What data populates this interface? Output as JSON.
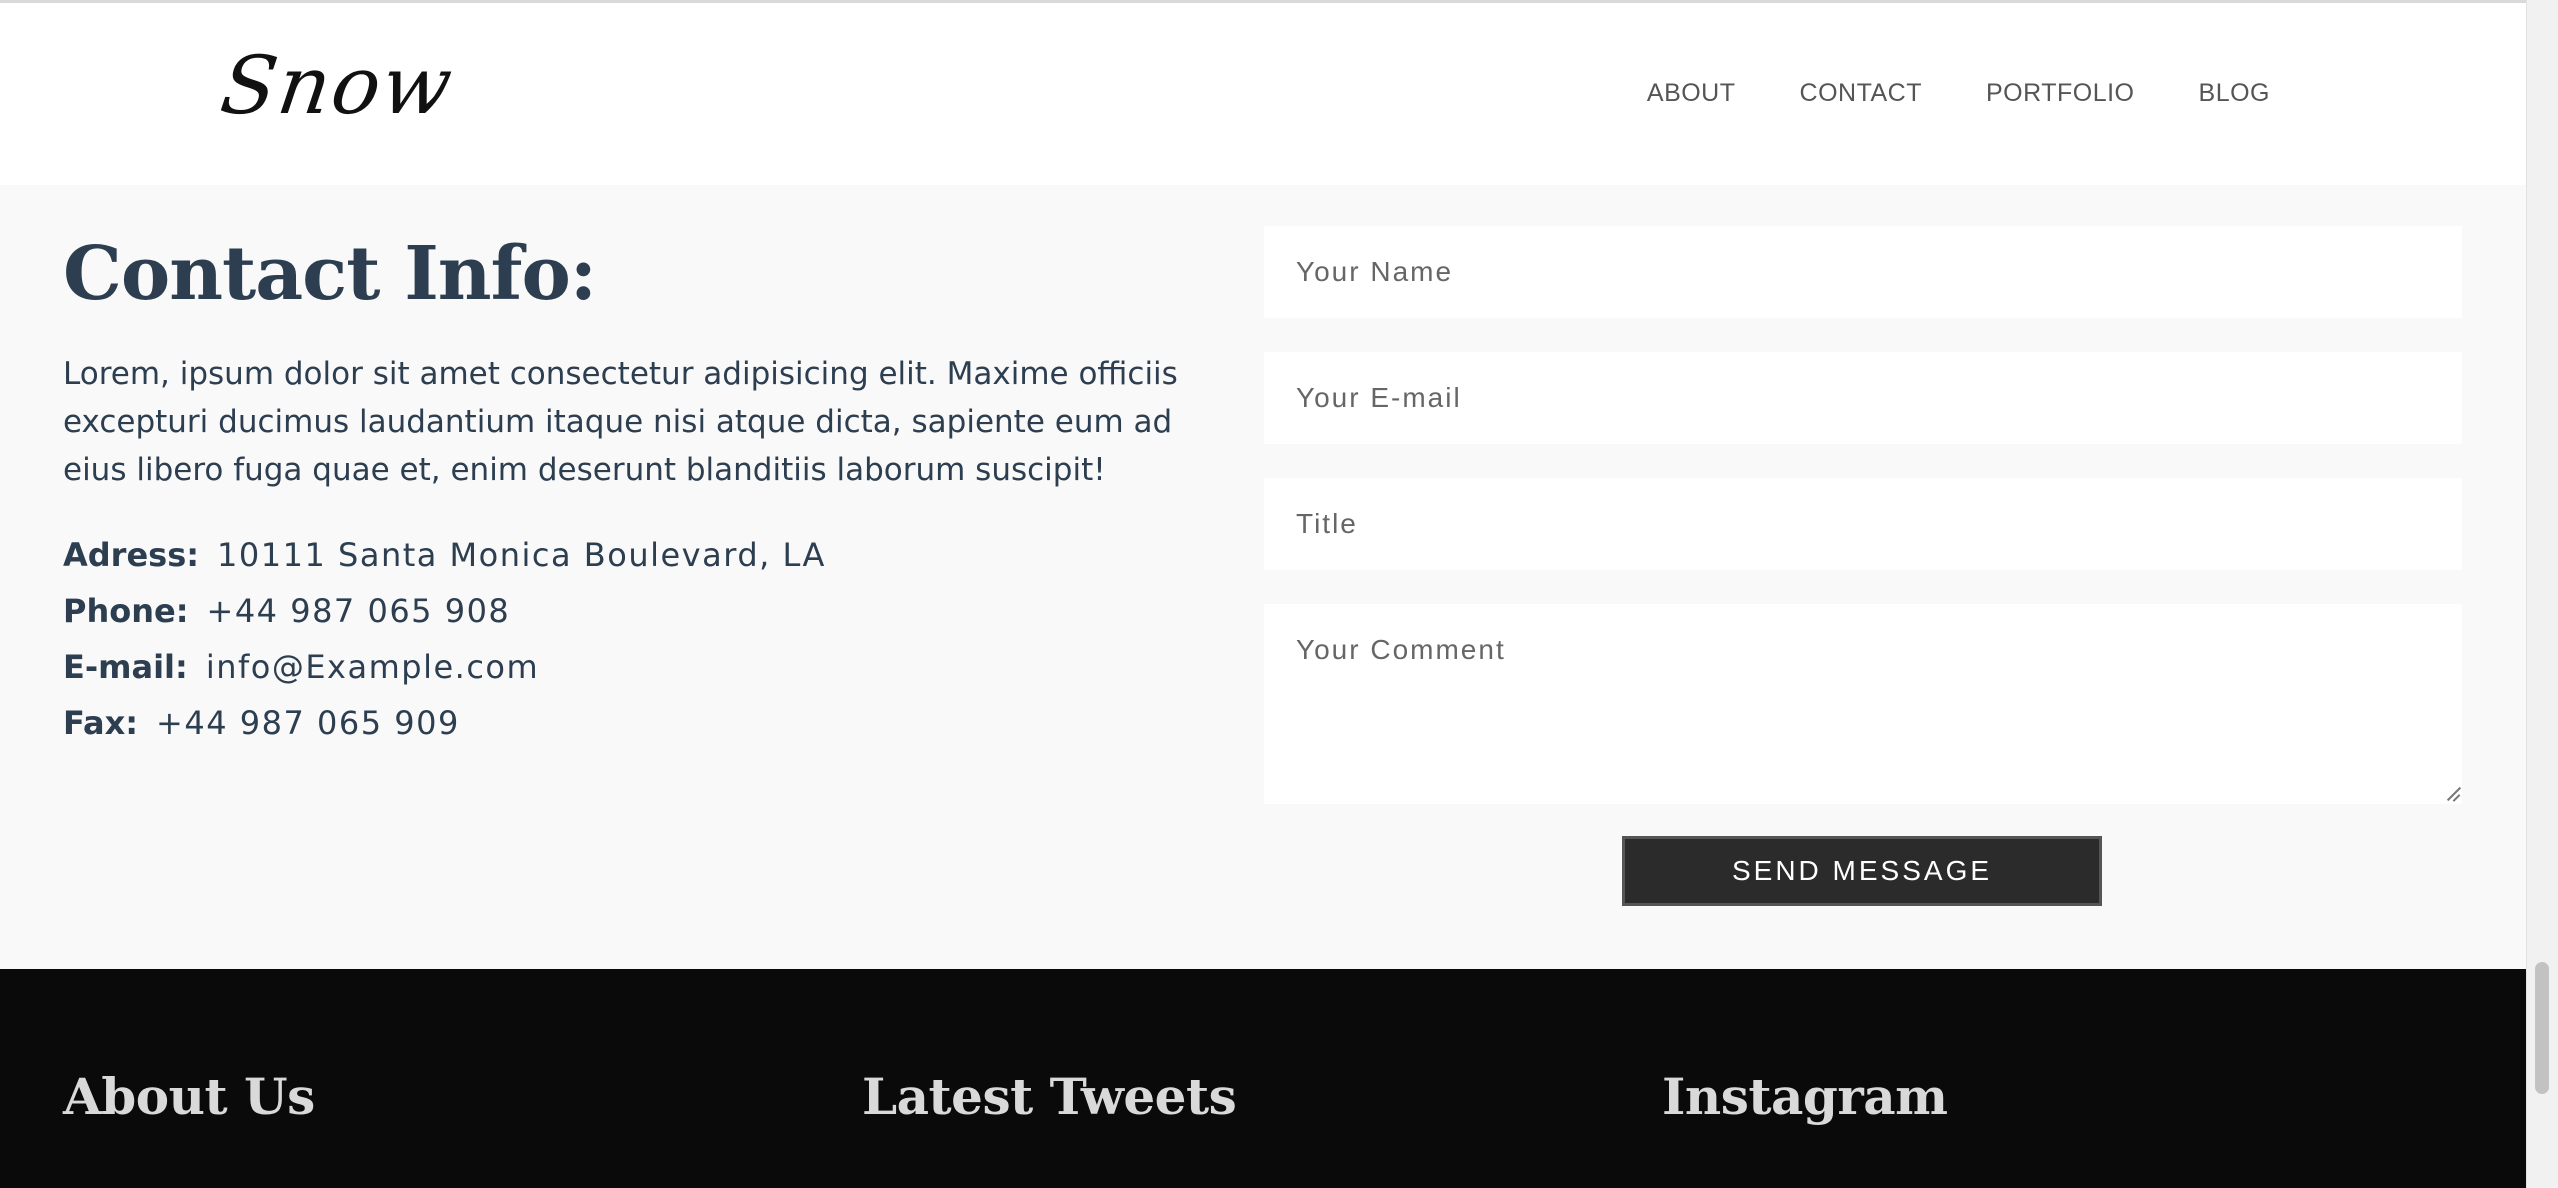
{
  "header": {
    "logo": "Snow",
    "nav": [
      "ABOUT",
      "CONTACT",
      "PORTFOLIO",
      "BLOG"
    ]
  },
  "contact": {
    "title": "Contact Info:",
    "description": "Lorem, ipsum dolor sit amet consectetur adipisicing elit. Maxime officiis excepturi ducimus laudantium itaque nisi atque dicta, sapiente eum ad eius libero fuga quae et, enim deserunt blanditiis laborum suscipit!",
    "details": [
      {
        "label": "Adress:",
        "value": "10111 Santa Monica Boulevard, LA"
      },
      {
        "label": "Phone:",
        "value": "+44 987 065 908"
      },
      {
        "label": "E-mail:",
        "value": "info@Example.com"
      },
      {
        "label": "Fax:",
        "value": "+44 987 065 909"
      }
    ]
  },
  "form": {
    "name_placeholder": "Your Name",
    "email_placeholder": "Your E-mail",
    "title_placeholder": "Title",
    "comment_placeholder": "Your Comment",
    "submit_label": "SEND MESSAGE"
  },
  "footer": {
    "about_title": "About Us",
    "tweets_title": "Latest Tweets",
    "instagram_title": "Instagram"
  },
  "colors": {
    "heading": "#2c3e50",
    "section_bg": "#f9f9f9",
    "footer_bg": "#0a0a0a",
    "button_bg": "#2b2b2b"
  }
}
